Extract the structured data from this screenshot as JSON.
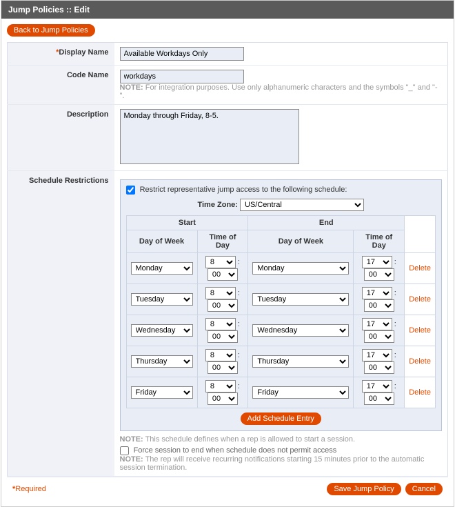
{
  "header": {
    "title": "Jump Policies :: Edit"
  },
  "topBtn": {
    "back": "Back to Jump Policies"
  },
  "form": {
    "displayName": {
      "label": "Display Name",
      "value": "Available Workdays Only"
    },
    "codeName": {
      "label": "Code Name",
      "value": "workdays",
      "noteBold": "NOTE:",
      "noteText": " For integration purposes. Use only alphanumeric characters and the symbols \"_\" and \"-\"."
    },
    "description": {
      "label": "Description",
      "value": "Monday through Friday, 8-5."
    },
    "schedule": {
      "label": "Schedule Restrictions",
      "restrictChecked": true,
      "restrictLabel": "Restrict representative jump access to the following schedule:",
      "tzLabel": "Time Zone:",
      "tzValue": "US/Central",
      "colStart": "Start",
      "colEnd": "End",
      "colDow": "Day of Week",
      "colTod": "Time of Day",
      "deleteLabel": "Delete",
      "addBtn": "Add Schedule Entry",
      "rows": [
        {
          "startDay": "Monday",
          "startHr": "8",
          "startMin": "00",
          "endDay": "Monday",
          "endHr": "17",
          "endMin": "00"
        },
        {
          "startDay": "Tuesday",
          "startHr": "8",
          "startMin": "00",
          "endDay": "Tuesday",
          "endHr": "17",
          "endMin": "00"
        },
        {
          "startDay": "Wednesday",
          "startHr": "8",
          "startMin": "00",
          "endDay": "Wednesday",
          "endHr": "17",
          "endMin": "00"
        },
        {
          "startDay": "Thursday",
          "startHr": "8",
          "startMin": "00",
          "endDay": "Thursday",
          "endHr": "17",
          "endMin": "00"
        },
        {
          "startDay": "Friday",
          "startHr": "8",
          "startMin": "00",
          "endDay": "Friday",
          "endHr": "17",
          "endMin": "00"
        }
      ],
      "note1Bold": "NOTE:",
      "note1Text": " This schedule defines when a rep is allowed to start a session.",
      "forceChecked": false,
      "forceLabel": " Force session to end when schedule does not permit access",
      "note2Bold": "NOTE:",
      "note2Text": " The rep will receive recurring notifications starting 15 minutes prior to the automatic session termination."
    }
  },
  "footer": {
    "requiredLabel": "Required",
    "save": "Save Jump Policy",
    "cancel": "Cancel"
  }
}
